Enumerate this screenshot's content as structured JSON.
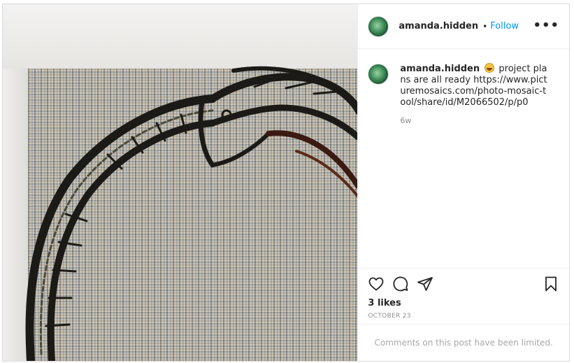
{
  "post": {
    "username": "amanda.hidden",
    "separator": "•",
    "follow_label": "Follow",
    "more_label": "•••",
    "avatar_icon": "profile-avatar",
    "caption": {
      "username": "amanda.hidden",
      "emoji": "grinning-face-emoji",
      "text": "project plans are all ready https://www.picturemosaics.com/photo-mosaic-tool/share/id/M2066502/p/p0",
      "time_ago": "6w"
    },
    "actions": {
      "like_icon": "heart-icon",
      "comment_icon": "comment-icon",
      "share_icon": "share-icon",
      "save_icon": "bookmark-icon"
    },
    "likes": "3 likes",
    "date": "OCTOBER 23",
    "comments_limited": "Comments on this post have been limited."
  },
  "colors": {
    "link_blue": "#0095f6",
    "text_primary": "#262626",
    "text_secondary": "#8e8e8e",
    "border": "#dbdbdb"
  }
}
